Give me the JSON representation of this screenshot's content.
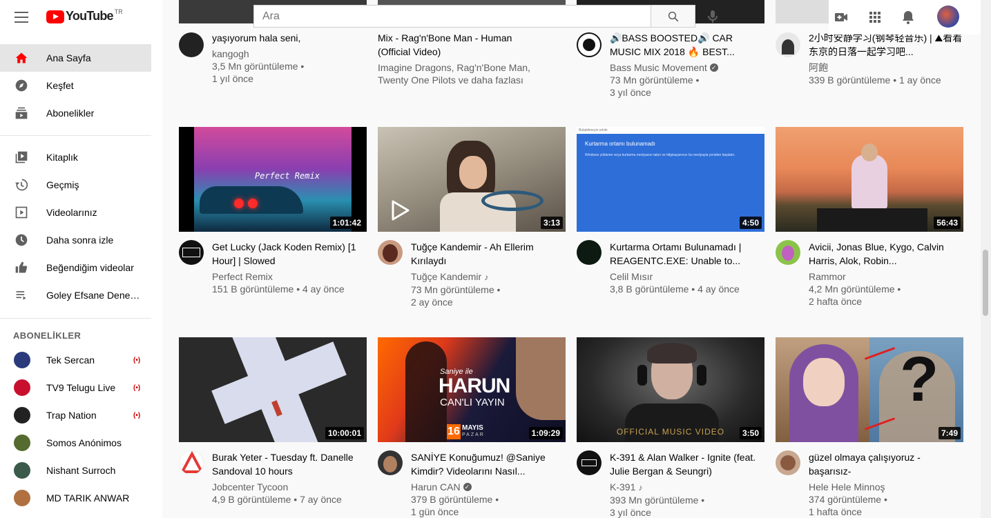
{
  "header": {
    "logo_text": "YouTube",
    "country": "TR",
    "search_placeholder": "Ara"
  },
  "sidebar": {
    "main": [
      {
        "label": "Ana Sayfa",
        "icon": "home-icon",
        "active": true
      },
      {
        "label": "Keşfet",
        "icon": "compass-icon"
      },
      {
        "label": "Abonelikler",
        "icon": "subscriptions-icon"
      }
    ],
    "library": [
      {
        "label": "Kitaplık",
        "icon": "library-icon"
      },
      {
        "label": "Geçmiş",
        "icon": "history-icon"
      },
      {
        "label": "Videolarınız",
        "icon": "your-videos-icon"
      },
      {
        "label": "Daha sonra izle",
        "icon": "watch-later-icon"
      },
      {
        "label": "Beğendiğim videolar",
        "icon": "thumbs-up-icon"
      },
      {
        "label": "Goley Efsane Denemeleri",
        "icon": "playlist-icon"
      }
    ],
    "subscriptions_title": "ABONELİKLER",
    "subscriptions": [
      {
        "label": "Tek Sercan",
        "live": true,
        "color": "#2a3a7a"
      },
      {
        "label": "TV9 Telugu Live",
        "live": true,
        "color": "#c8102e"
      },
      {
        "label": "Trap Nation",
        "live": true,
        "color": "#222222"
      },
      {
        "label": "Somos Anónimos",
        "live": false,
        "color": "#556b2f"
      },
      {
        "label": "Nishant Surroch",
        "live": false,
        "color": "#3b5a4a"
      },
      {
        "label": "MD TARIK ANWAR",
        "live": false,
        "color": "#b07040"
      }
    ]
  },
  "row1": [
    {
      "title": "yaşıyorum hala seni,",
      "channel": "kangogh",
      "stats1": "3,5 Mn görüntüleme •",
      "stats2": "1 yıl önce"
    },
    {
      "title": "Mix - Rag'n'Bone Man - Human (Official Video)",
      "channel": "Imagine Dragons, Rag'n'Bone Man,",
      "stats1": "Twenty One Pilots ve daha fazlası",
      "stats2": ""
    },
    {
      "title": "🔊BASS BOOSTED🔊 CAR MUSIC MIX 2018 🔥 BEST...",
      "channel": "Bass Music Movement",
      "verified": true,
      "stats1": "73 Mn görüntüleme •",
      "stats2": "3 yıl önce"
    },
    {
      "title": "2小时安静学习(钢琴轻音乐) | ⛰看着东京的日落一起学习吧...",
      "channel": "阿飽",
      "stats1": "339 B görüntüleme • 1 ay önce",
      "stats2": ""
    }
  ],
  "row2": [
    {
      "title": "Get Lucky (Jack Koden Remix) [1 Hour] | Slowed",
      "channel": "Perfect Remix",
      "stats1": "151 B görüntüleme • 4 ay önce",
      "stats2": "",
      "duration": "1:01:42",
      "overlay": "Perfect Remix"
    },
    {
      "title": "Tuğçe Kandemir - Ah Ellerim Kırılaydı",
      "channel": "Tuğçe Kandemir",
      "music": true,
      "stats1": "73 Mn görüntüleme •",
      "stats2": "2 ay önce",
      "duration": "3:13"
    },
    {
      "title": "Kurtarma Ortamı Bulunamadı | REAGENTC.EXE: Unable to...",
      "channel": "Celil Mısır",
      "stats1": "3,8 B görüntüleme • 4 ay önce",
      "stats2": "",
      "duration": "4:50",
      "overlay": "Kurtarma ortamı bulunamadı",
      "small_top": "Bulabilmeyin erkile",
      "small_text": "Windows yükleme veya kurtarma medyasını takın ve bilgisayarınızı bu medyayla yeniden başlatın."
    },
    {
      "title": "Avicii, Jonas Blue, Kygo, Calvin Harris, Alok, Robin...",
      "channel": "Rammor",
      "stats1": "4,2 Mn görüntüleme •",
      "stats2": "2 hafta önce",
      "duration": "56:43"
    }
  ],
  "row3": [
    {
      "title": "Burak Yeter - Tuesday ft. Danelle Sandoval 10 hours",
      "channel": "Jobcenter Tycoon",
      "stats1": "4,9 B görüntüleme • 7 ay önce",
      "stats2": "",
      "duration": "10:00:01"
    },
    {
      "title": "SANİYE Konuğumuz! @Saniye Kimdir? Videolarını Nasıl...",
      "channel": "Harun CAN",
      "verified": true,
      "stats1": "379 B görüntüleme •",
      "stats2": "1 gün önce",
      "duration": "1:09:29",
      "overlay1": "Saniye ile",
      "overlay2": "HARUN",
      "overlay3": "CAN'LI YAYIN",
      "day": "16",
      "month": "MAYIS",
      "weekday": "PAZAR"
    },
    {
      "title": "K-391 & Alan Walker - Ignite (feat. Julie Bergan & Seungri)",
      "channel": "K-391",
      "music": true,
      "stats1": "393 Mn görüntüleme •",
      "stats2": "3 yıl önce",
      "duration": "3:50",
      "overlay": "OFFICIAL MUSIC VIDEO"
    },
    {
      "title": "güzel olmaya çalışıyoruz - başarısız-",
      "channel": "Hele Hele Minnoş",
      "stats1": "374 görüntüleme •",
      "stats2": "1 hafta önce",
      "duration": "7:49",
      "overlay": "?"
    }
  ]
}
